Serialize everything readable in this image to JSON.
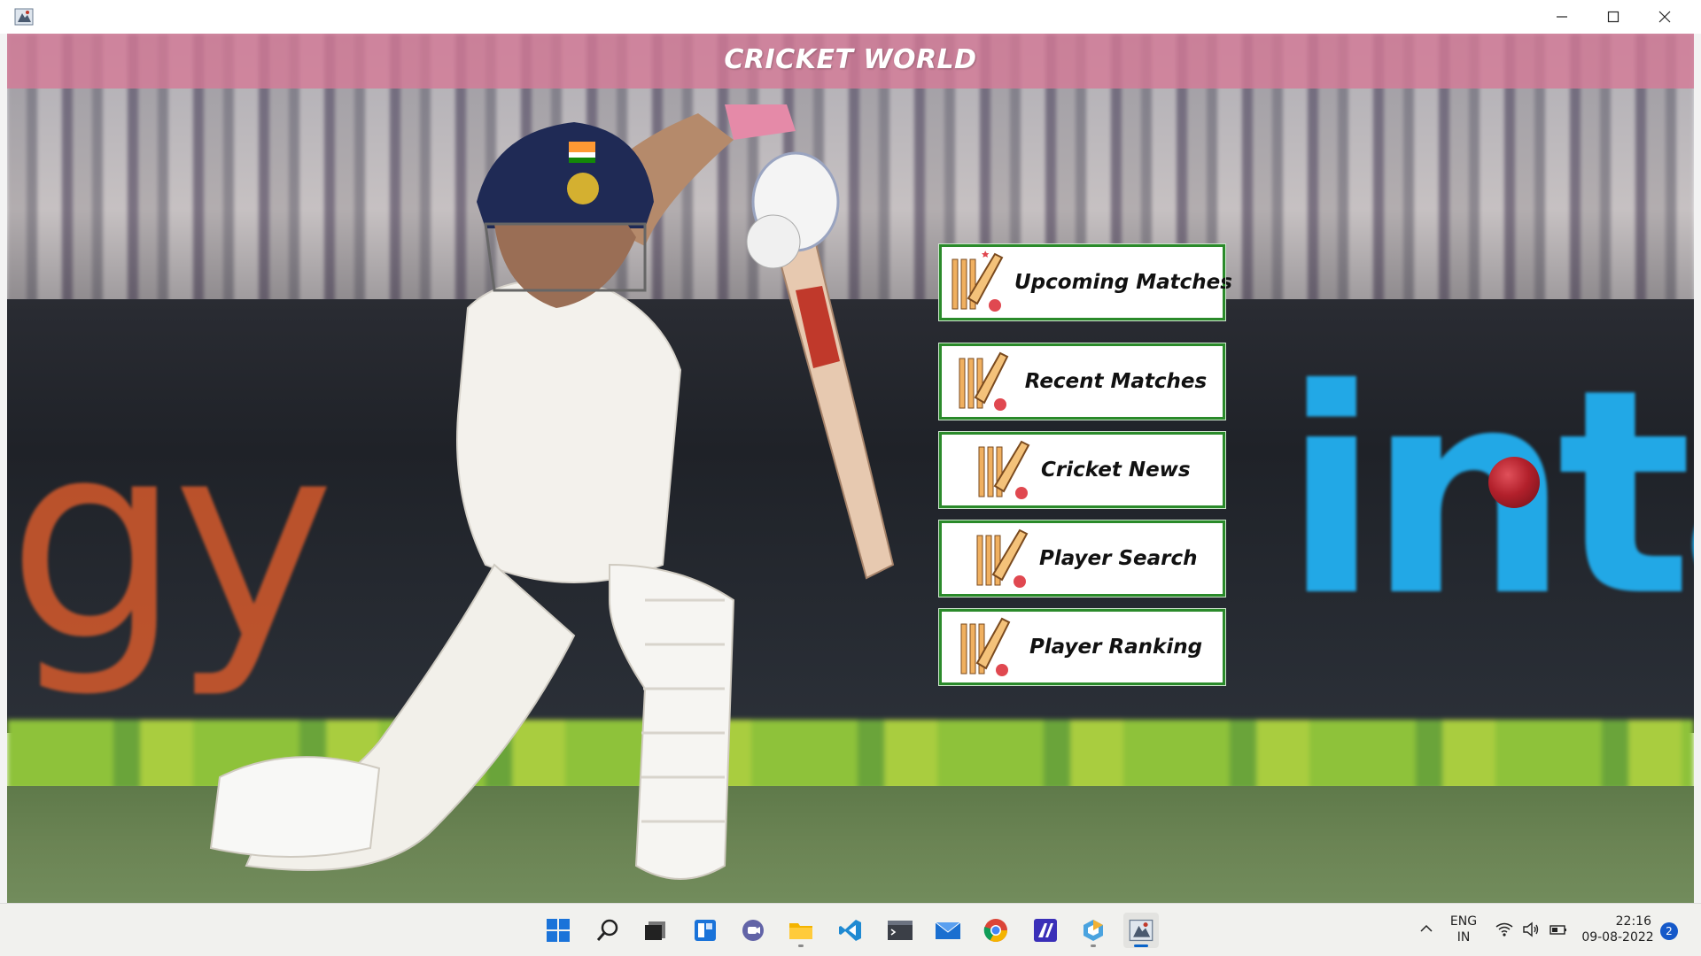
{
  "window": {
    "app_icon": "java-app-icon",
    "controls": [
      "minimize-icon",
      "maximize-icon",
      "close-icon"
    ]
  },
  "header": {
    "title": "CRICKET WORLD"
  },
  "menu": {
    "items": [
      {
        "label": "Upcoming Matches",
        "icon": "cricket-bat-icon"
      },
      {
        "label": "Recent Matches",
        "icon": "cricket-bat-icon"
      },
      {
        "label": "Cricket News",
        "icon": "cricket-bat-icon"
      },
      {
        "label": "Player Search",
        "icon": "cricket-bat-icon"
      },
      {
        "label": "Player Ranking",
        "icon": "cricket-bat-icon"
      }
    ]
  },
  "taskbar": {
    "apps": [
      "start-icon",
      "search-icon",
      "task-view-icon",
      "widgets-icon",
      "teams-chat-icon",
      "file-explorer-icon",
      "vscode-icon",
      "terminal-icon",
      "mail-icon",
      "chrome-icon",
      "app-icon",
      "vpn-icon",
      "java-app-icon"
    ],
    "tray": {
      "language_line1": "ENG",
      "language_line2": "IN",
      "time": "22:16",
      "date": "09-08-2022",
      "notifications": "2"
    }
  },
  "colors": {
    "banner": "#d6789a",
    "button_border": "#2a8a2a",
    "accent_blue": "#22a8e6",
    "accent_orange": "#d55a2c"
  }
}
